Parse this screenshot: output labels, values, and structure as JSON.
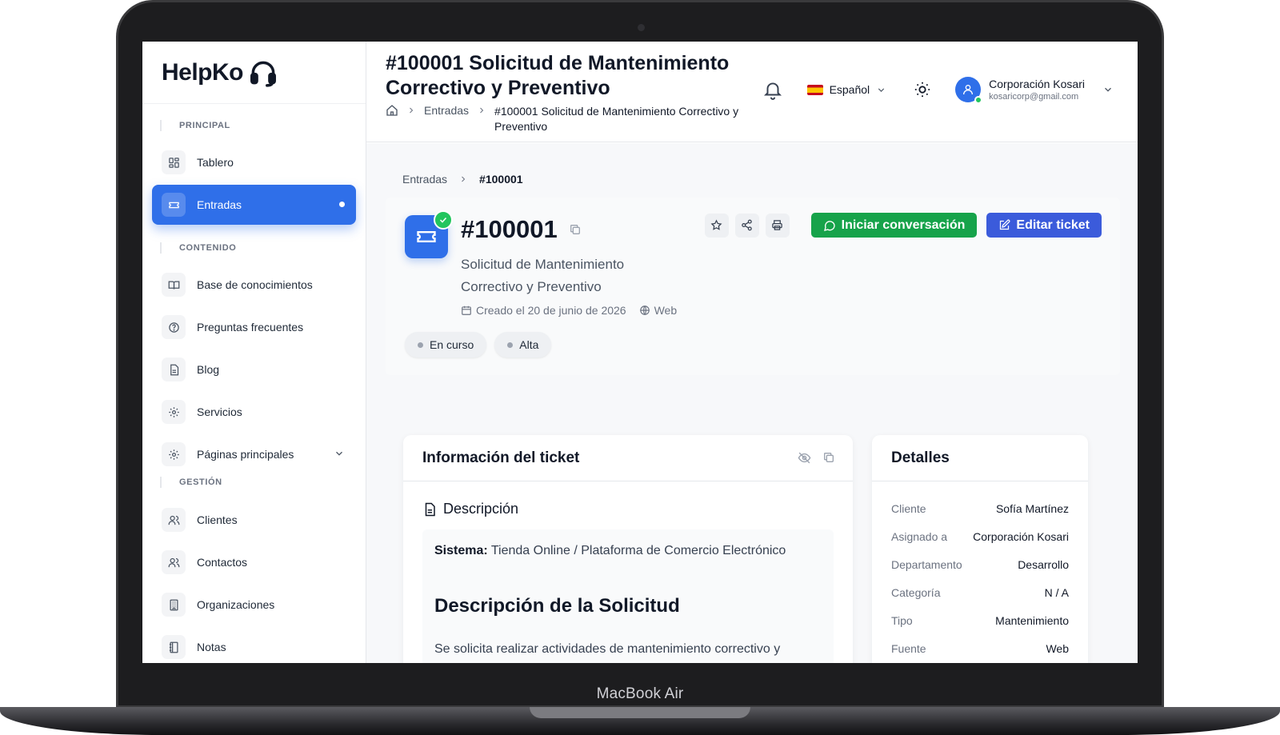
{
  "device_label": "MacBook Air",
  "brand": {
    "name": "HelpKo"
  },
  "sidebar": {
    "sections": [
      {
        "label": "PRINCIPAL",
        "items": [
          {
            "label": "Tablero",
            "icon": "dashboard-icon"
          },
          {
            "label": "Entradas",
            "icon": "ticket-icon",
            "active": true
          }
        ]
      },
      {
        "label": "CONTENIDO",
        "items": [
          {
            "label": "Base de conocimientos",
            "icon": "book-icon"
          },
          {
            "label": "Preguntas frecuentes",
            "icon": "question-icon"
          },
          {
            "label": "Blog",
            "icon": "document-icon"
          },
          {
            "label": "Servicios",
            "icon": "gear-icon"
          },
          {
            "label": "Páginas principales",
            "icon": "gear-icon",
            "expandable": true
          }
        ]
      },
      {
        "label": "GESTIÓN",
        "items": [
          {
            "label": "Clientes",
            "icon": "users-icon"
          },
          {
            "label": "Contactos",
            "icon": "users-icon"
          },
          {
            "label": "Organizaciones",
            "icon": "building-icon"
          },
          {
            "label": "Notas",
            "icon": "notebook-icon"
          }
        ]
      }
    ]
  },
  "header": {
    "title": "#100001 Solicitud de Mantenimiento Correctivo y Preventivo",
    "breadcrumb": {
      "parent": "Entradas",
      "current": "#100001 Solicitud de Mantenimiento Correctivo y Preventivo"
    },
    "language": "Español",
    "user": {
      "name": "Corporación Kosari",
      "email": "kosaricorp@gmail.com"
    }
  },
  "main": {
    "breadcrumb": {
      "parent": "Entradas",
      "current": "#100001"
    },
    "ticket": {
      "number": "#100001",
      "subject": "Solicitud de Mantenimiento Correctivo y Preventivo",
      "created": "Creado el 20 de junio de 2026",
      "source": "Web",
      "status": "En curso",
      "priority": "Alta",
      "btn_conversation": "Iniciar conversación",
      "btn_edit": "Editar ticket"
    },
    "info": {
      "title": "Información del ticket",
      "desc_title": "Descripción",
      "system_label": "Sistema:",
      "system_value": "Tienda Online / Plataforma de Comercio Electrónico",
      "heading": "Descripción de la Solicitud",
      "paragraph": "Se solicita realizar actividades de mantenimiento correctivo y preventivo sobre el sistema de tienda online con el fin de"
    },
    "details": {
      "title": "Detalles",
      "rows": [
        {
          "label": "Cliente",
          "value": "Sofía Martínez"
        },
        {
          "label": "Asignado a",
          "value": "Corporación Kosari"
        },
        {
          "label": "Departamento",
          "value": "Desarrollo"
        },
        {
          "label": "Categoría",
          "value": "N / A"
        },
        {
          "label": "Tipo",
          "value": "Mantenimiento"
        },
        {
          "label": "Fuente",
          "value": "Web"
        }
      ]
    }
  },
  "colors": {
    "primary": "#2f6fe9",
    "success": "#16a34a",
    "edit": "#3b5bdb"
  }
}
